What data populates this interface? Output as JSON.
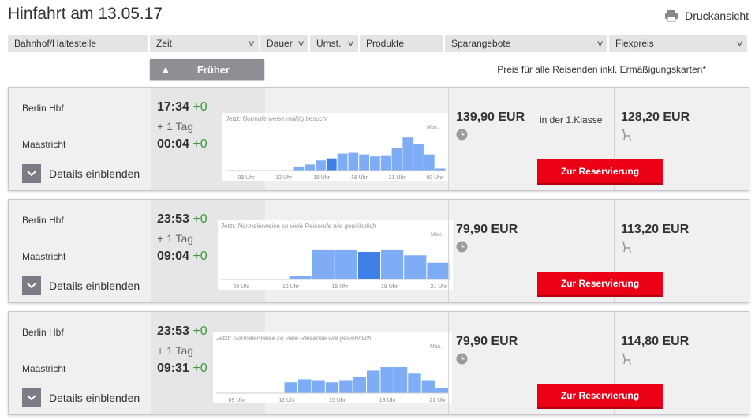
{
  "header": {
    "title": "Hinfahrt am 13.05.17",
    "print_label": "Druckansicht"
  },
  "columns": [
    {
      "label": "Bahnhof/Haltestelle",
      "chevron": false
    },
    {
      "label": "Zeit",
      "chevron": true
    },
    {
      "label": "Dauer",
      "chevron": true
    },
    {
      "label": "Umst.",
      "chevron": true
    },
    {
      "label": "Produkte",
      "chevron": false
    },
    {
      "label": "Sparangebote",
      "chevron": true
    },
    {
      "label": "Flexpreis",
      "chevron": true
    }
  ],
  "earlier_label": "Früher",
  "price_note": "Preis für alle Reisenden inkl. Ermäßigungskarten*",
  "connections": [
    {
      "from": "Berlin Hbf",
      "to": "Maastricht",
      "dep": "17:34",
      "dep_delay": "+0",
      "plus_day": "+ 1 Tag",
      "arr": "00:04",
      "arr_delay": "+0",
      "details_label": "Details einblenden",
      "chart_caption": "Jetzt: Normalerweise mäßig besucht",
      "chart_max": "Max.",
      "chart_ticks": [
        "09 Uhr",
        "12 Uhr",
        "15 Uhr",
        "18 Uhr",
        "21 Uhr",
        "00 Uhr"
      ],
      "occupancy": [
        0.1,
        0.15,
        0.25,
        0.3,
        0.42,
        0.44,
        0.4,
        0.35,
        0.38,
        0.55,
        0.82,
        0.65,
        0.4,
        0.05
      ],
      "highlight": 3,
      "saver_price": "139,90 EUR",
      "class_note": "in der 1.Klasse",
      "flex_price": "128,20 EUR",
      "reserve_label": "Zur Reservierung"
    },
    {
      "from": "Berlin Hbf",
      "to": "Maastricht",
      "dep": "23:53",
      "dep_delay": "+0",
      "plus_day": "+ 1 Tag",
      "arr": "09:04",
      "arr_delay": "+0",
      "details_label": "Details einblenden",
      "chart_caption": "Jetzt: Normalerweise so viele Reisende wie gewöhnlich",
      "chart_max": "Max.",
      "chart_ticks": [
        "09 Uhr",
        "12 Uhr",
        "15 Uhr",
        "18 Uhr",
        "21 Uhr"
      ],
      "occupancy": [
        0.08,
        0.7,
        0.7,
        0.66,
        0.7,
        0.58,
        0.4
      ],
      "highlight": 3,
      "saver_price": "79,90 EUR",
      "class_note": "",
      "flex_price": "113,20 EUR",
      "reserve_label": "Zur Reservierung"
    },
    {
      "from": "Berlin Hbf",
      "to": "Maastricht",
      "dep": "23:53",
      "dep_delay": "+0",
      "plus_day": "+ 1 Tag",
      "arr": "09:31",
      "arr_delay": "+0",
      "details_label": "Details einblenden",
      "chart_caption": "Jetzt: Normalerweise so viele Reisende wie gewöhnlich",
      "chart_max": "Max.",
      "chart_ticks": [
        "09 Uhr",
        "12 Uhr",
        "15 Uhr",
        "18 Uhr",
        "21 Uhr"
      ],
      "occupancy": [
        0.25,
        0.32,
        0.3,
        0.25,
        0.3,
        0.38,
        0.52,
        0.6,
        0.6,
        0.45,
        0.3,
        0.12
      ],
      "highlight": -1,
      "saver_price": "79,90 EUR",
      "class_note": "",
      "flex_price": "114,80 EUR",
      "reserve_label": "Zur Reservierung"
    }
  ],
  "colors": {
    "accent_red": "#ec0016",
    "bar": "#7fadf5",
    "bar_highlight": "#3f7fe8",
    "delay_green": "#3a9a3a"
  }
}
